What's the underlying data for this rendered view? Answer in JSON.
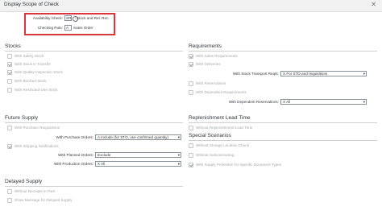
{
  "window": {
    "title": "Display Scope of Check",
    "close_glyph": "✕"
  },
  "header": {
    "availability_check_label": "Availability Check:",
    "availability_check_value": "SR",
    "availability_check_text": "Stock and Rel. Rec.",
    "checking_rule_label": "Checking Rule:",
    "checking_rule_value": "A",
    "checking_rule_text": "Sales Order"
  },
  "stocks": {
    "title": "Stocks",
    "items": [
      {
        "label": "With Safety Stock",
        "checked": false
      },
      {
        "label": "With Stock in Transfer",
        "checked": true
      },
      {
        "label": "With Quality Inspection Stock",
        "checked": true
      },
      {
        "label": "With Blocked Stock",
        "checked": false
      },
      {
        "label": "With Restricted-Use Stock",
        "checked": false
      }
    ]
  },
  "requirements": {
    "title": "Requirements",
    "items": [
      {
        "label": "With Sales Requirements",
        "checked": true
      },
      {
        "label": "With Deliveries",
        "checked": true
      }
    ],
    "stock_transport_label": "With Stock Transport Reqts:",
    "stock_transport_value": "X For STO and requisitions",
    "reservations_label": "With Reservations",
    "dependent_reqs_label": "With Dependent Requirements",
    "dependent_res_label": "With Dependent Reservations:",
    "dependent_res_value": "X All"
  },
  "future_supply": {
    "title": "Future Supply",
    "purchase_reqs_label": "With Purchase Requisitions",
    "purchase_orders_label": "With Purchase Orders:",
    "purchase_orders_value": "A Include (for STO, use confirmed quantity)",
    "shipping_notifications_label": "With Shipping Notifications",
    "planned_orders_label": "With Planned Orders:",
    "planned_orders_value": "Exclude",
    "production_orders_label": "With Production Orders:",
    "production_orders_value": "X All"
  },
  "replenishment": {
    "title": "Replenishment Lead Time",
    "item_label": "Without Replenishment Lead Time"
  },
  "special": {
    "title": "Special Scenarios",
    "items": [
      {
        "label": "Without Storage Location Check",
        "checked": false
      },
      {
        "label": "Without Subcontracting",
        "checked": false
      },
      {
        "label": "With Supply Protection for Specific Document Types",
        "checked": true
      }
    ]
  },
  "delayed": {
    "title": "Delayed Supply",
    "items": [
      {
        "label": "Without Receipts in Past",
        "checked": false
      },
      {
        "label": "Show Message for Delayed Supply",
        "checked": false
      }
    ]
  },
  "icons": {
    "info": "i",
    "dropdown": "▾"
  },
  "colors": {
    "highlight": "#d9363e"
  }
}
